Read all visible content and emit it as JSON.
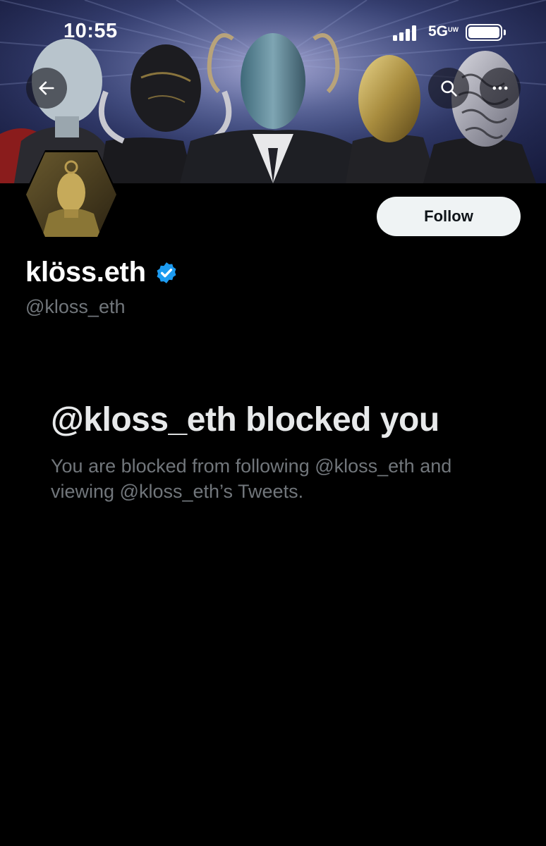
{
  "status_bar": {
    "time": "10:55",
    "network": "5G",
    "network_sup": "UW"
  },
  "header": {
    "back_icon": "arrow-left-icon",
    "search_icon": "search-icon",
    "more_icon": "more-horizontal-icon"
  },
  "profile": {
    "display_name": "klöss.eth",
    "verified_icon": "verified-badge-icon",
    "handle": "@kloss_eth",
    "follow_label": "Follow"
  },
  "blocked": {
    "title": "@kloss_eth blocked you",
    "body": "You are blocked from following @kloss_eth and viewing @kloss_eth’s Tweets."
  },
  "colors": {
    "background": "#000000",
    "primary_text": "#e7e9ea",
    "secondary_text": "#71767b",
    "verified_blue": "#1d9bf0",
    "follow_bg": "#eff3f4"
  }
}
